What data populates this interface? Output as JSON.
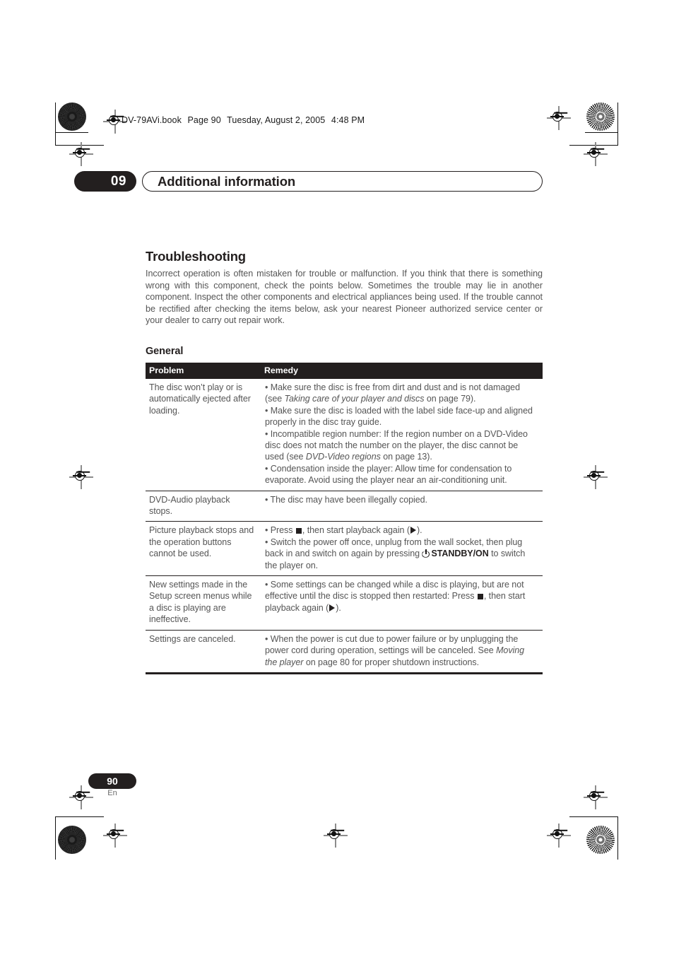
{
  "running_head": {
    "file": "DV-79AVi.book",
    "page_label": "Page 90",
    "date": "Tuesday, August 2, 2005",
    "time": "4:48 PM"
  },
  "chapter": {
    "number": "09",
    "title": "Additional information"
  },
  "section": {
    "title": "Troubleshooting",
    "intro": "Incorrect operation is often mistaken for trouble or malfunction. If you think that there is something wrong with this component, check the points below. Sometimes the trouble may lie in another component. Inspect the other components and electrical appliances being used. If the trouble cannot be rectified after checking the items below, ask your nearest Pioneer authorized service center or your dealer to carry out repair work.",
    "subsection_title": "General"
  },
  "table": {
    "headers": {
      "problem": "Problem",
      "remedy": "Remedy"
    },
    "rows": [
      {
        "problem": "The disc won’t play or is automatically ejected after loading.",
        "remedy_lines": [
          {
            "parts": [
              {
                "t": "text",
                "v": "• Make sure the disc is free from dirt and dust and is not damaged (see "
              },
              {
                "t": "italic",
                "v": "Taking care of your player and discs"
              },
              {
                "t": "text",
                "v": " on page 79)."
              }
            ]
          },
          {
            "parts": [
              {
                "t": "text",
                "v": "• Make sure the disc is loaded with the label side face-up and aligned properly in the disc tray guide."
              }
            ]
          },
          {
            "parts": [
              {
                "t": "text",
                "v": "• Incompatible region number: If the region number on a DVD-Video disc does not match the number on the player, the disc cannot be used (see "
              },
              {
                "t": "italic",
                "v": "DVD-Video regions"
              },
              {
                "t": "text",
                "v": " on page 13)."
              }
            ]
          },
          {
            "parts": [
              {
                "t": "text",
                "v": "• Condensation inside the player: Allow time for condensation to evaporate. Avoid using the player near an air-conditioning unit."
              }
            ]
          }
        ]
      },
      {
        "problem": "DVD-Audio playback stops.",
        "remedy_lines": [
          {
            "parts": [
              {
                "t": "text",
                "v": "• The disc may have been illegally copied."
              }
            ]
          }
        ]
      },
      {
        "problem": "Picture playback stops and the operation buttons cannot be used.",
        "remedy_lines": [
          {
            "parts": [
              {
                "t": "text",
                "v": "• Press "
              },
              {
                "t": "icon",
                "v": "stop-icon"
              },
              {
                "t": "text",
                "v": ", then start playback again ("
              },
              {
                "t": "icon",
                "v": "play-icon"
              },
              {
                "t": "text",
                "v": ")."
              }
            ]
          },
          {
            "parts": [
              {
                "t": "text",
                "v": "• Switch the power off once, unplug from the wall socket, then plug back in and switch on again by pressing "
              },
              {
                "t": "icon",
                "v": "power-icon"
              },
              {
                "t": "bold",
                "v": "STANDBY/ON"
              },
              {
                "t": "text",
                "v": " to switch the player on."
              }
            ]
          }
        ]
      },
      {
        "problem": "New settings made in the Setup screen menus while a disc is playing are ineffective.",
        "remedy_lines": [
          {
            "parts": [
              {
                "t": "text",
                "v": "• Some settings can be changed while a disc is playing, but are not effective until the disc is stopped then restarted: Press "
              },
              {
                "t": "icon",
                "v": "stop-icon"
              },
              {
                "t": "text",
                "v": ", then start playback again ("
              },
              {
                "t": "icon",
                "v": "play-icon"
              },
              {
                "t": "text",
                "v": ")."
              }
            ]
          }
        ]
      },
      {
        "problem": "Settings are canceled.",
        "remedy_lines": [
          {
            "parts": [
              {
                "t": "text",
                "v": "• When the power is cut due to power failure or by unplugging the power cord during operation, settings will be canceled. See "
              },
              {
                "t": "italic",
                "v": "Moving the player"
              },
              {
                "t": "text",
                "v": " on page 80 for proper shutdown instructions."
              }
            ]
          }
        ]
      }
    ]
  },
  "footer": {
    "page_number": "90",
    "language": "En"
  },
  "colors": {
    "ink": "#231f1f",
    "body_text": "#555555",
    "paper": "#ffffff"
  }
}
